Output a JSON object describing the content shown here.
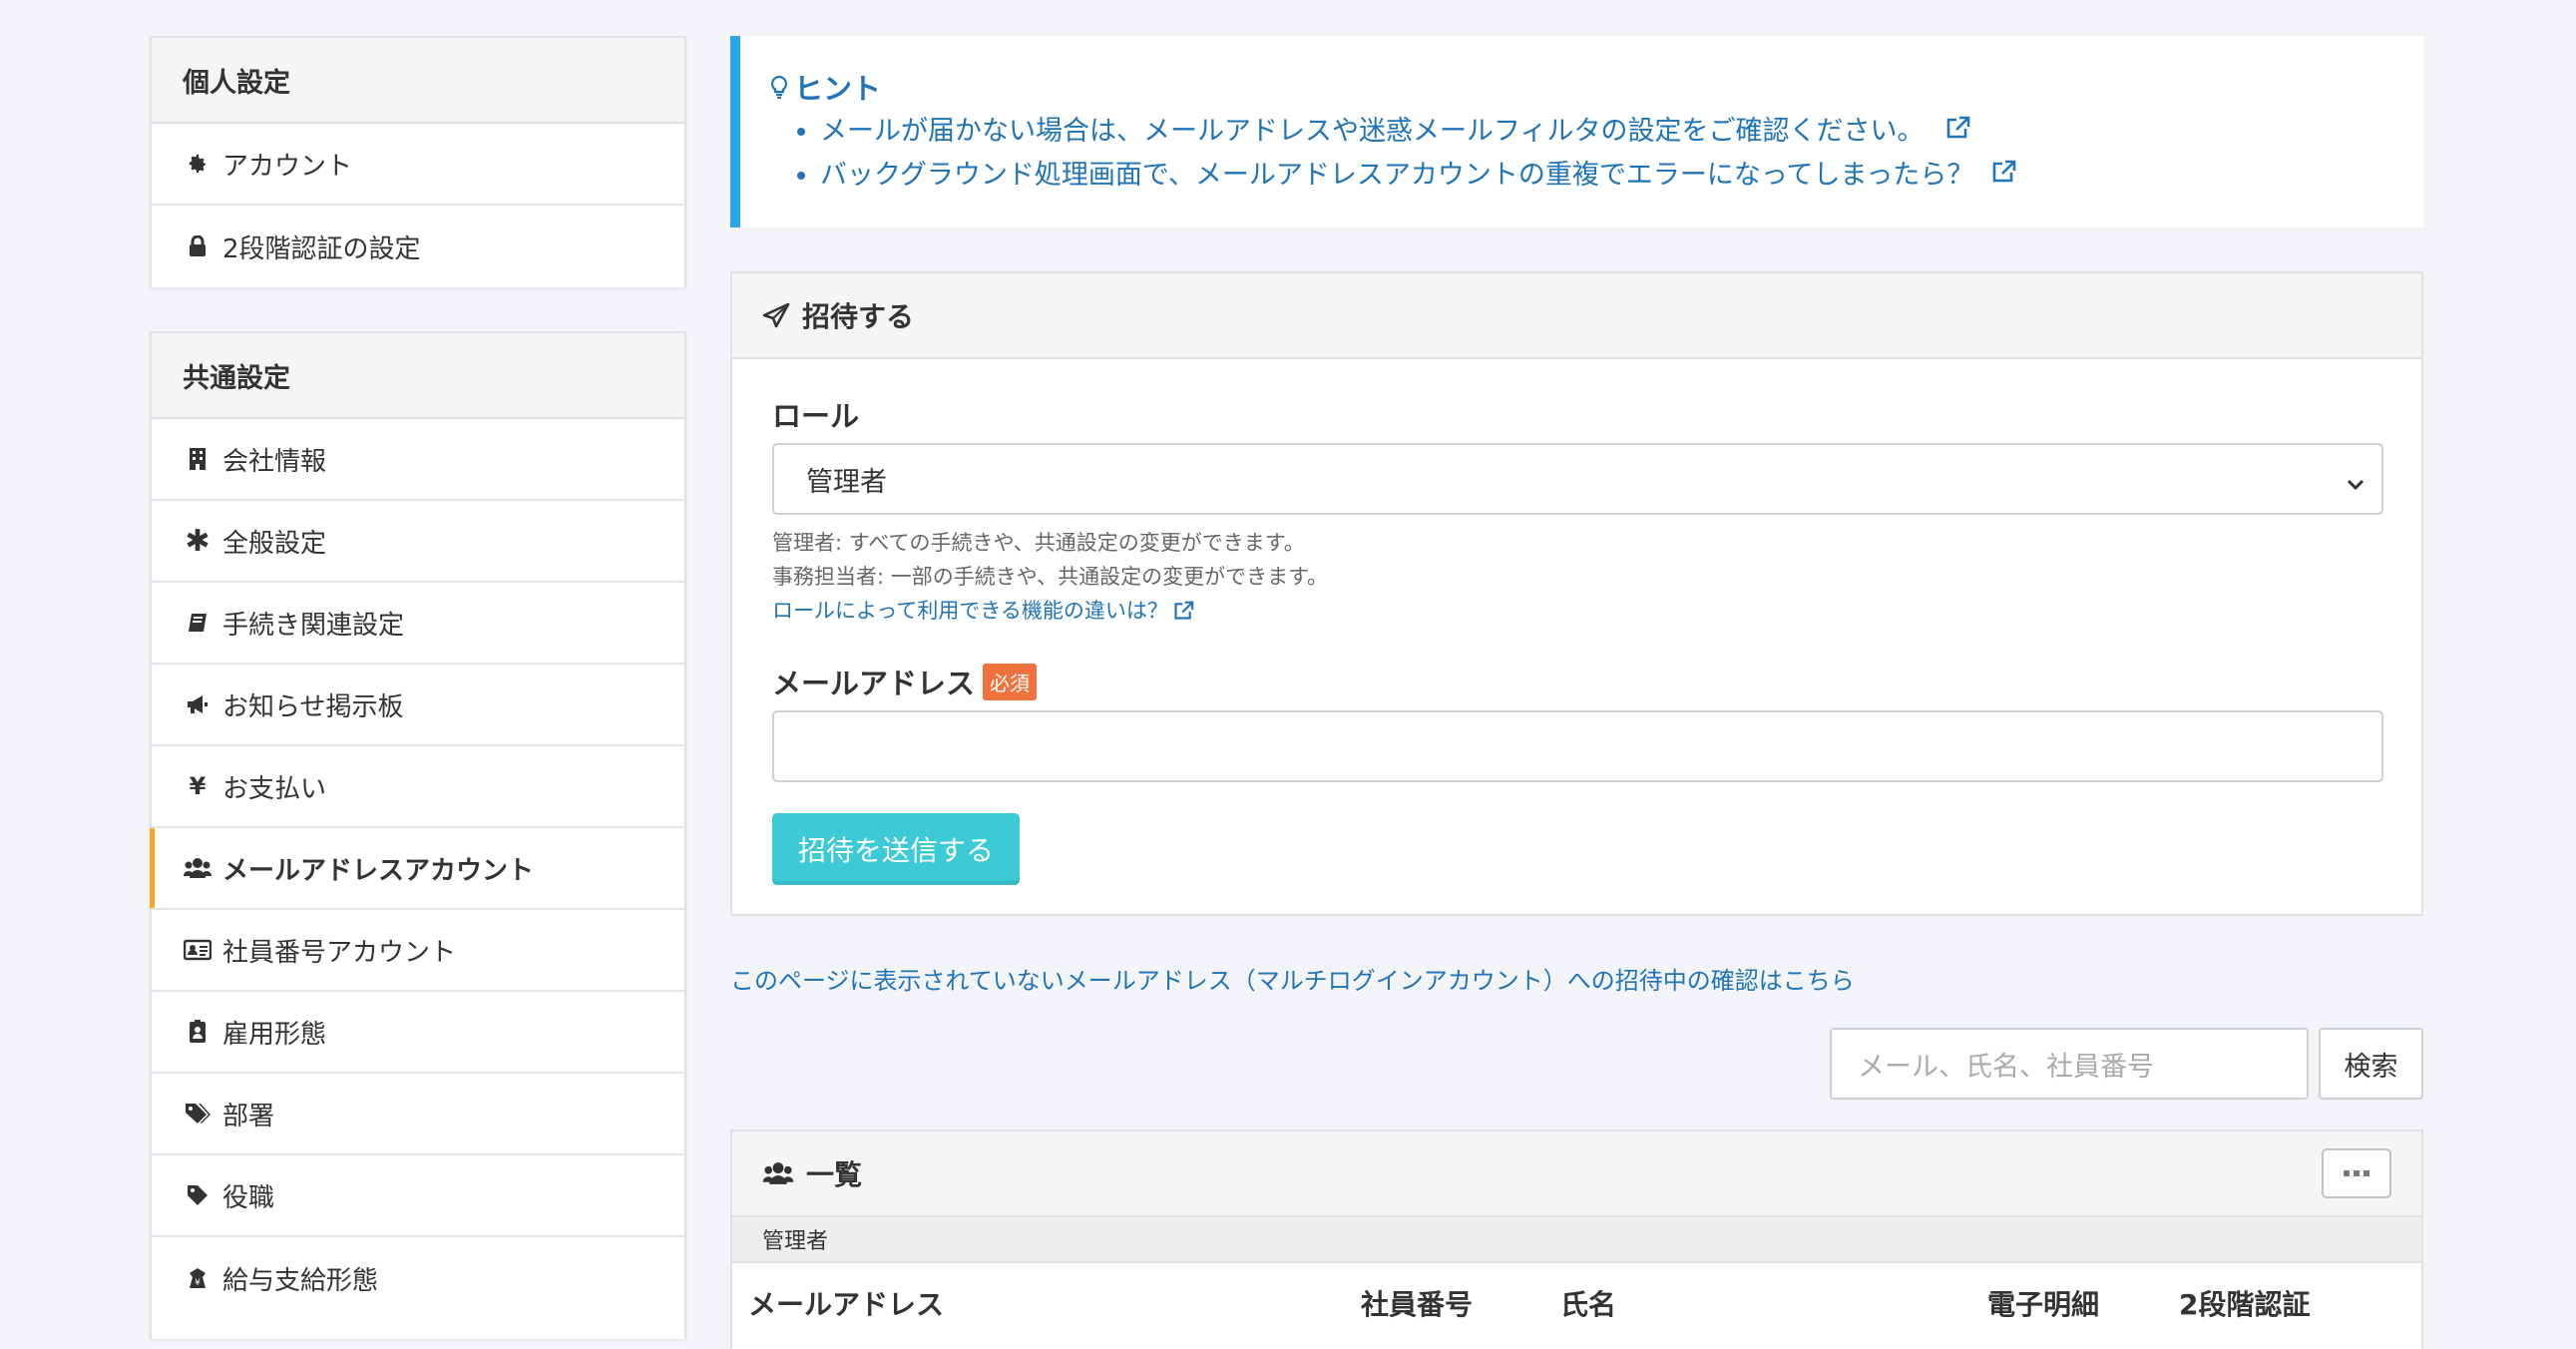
{
  "sidebar": {
    "personal": {
      "title": "個人設定",
      "items": [
        {
          "label": "アカウント",
          "icon": "gear-icon"
        },
        {
          "label": "2段階認証の設定",
          "icon": "lock-icon"
        }
      ]
    },
    "common": {
      "title": "共通設定",
      "items": [
        {
          "label": "会社情報",
          "icon": "building-icon"
        },
        {
          "label": "全般設定",
          "icon": "asterisk-icon"
        },
        {
          "label": "手続き関連設定",
          "icon": "book-icon"
        },
        {
          "label": "お知らせ掲示板",
          "icon": "megaphone-icon"
        },
        {
          "label": "お支払い",
          "icon": "yen-icon"
        },
        {
          "label": "メールアドレスアカウント",
          "icon": "users-icon",
          "active": true
        },
        {
          "label": "社員番号アカウント",
          "icon": "id-card-icon"
        },
        {
          "label": "雇用形態",
          "icon": "badge-icon"
        },
        {
          "label": "部署",
          "icon": "tags-icon"
        },
        {
          "label": "役職",
          "icon": "tag-icon"
        },
        {
          "label": "給与支給形態",
          "icon": "money-icon"
        }
      ]
    }
  },
  "hint": {
    "title": "ヒント",
    "items": [
      "メールが届かない場合は、メールアドレスや迷惑メールフィルタの設定をご確認ください。",
      "バックグラウンド処理画面で、メールアドレスアカウントの重複でエラーになってしまったら？"
    ]
  },
  "invite": {
    "title": "招待する",
    "role_label": "ロール",
    "role_value": "管理者",
    "help_admin": "管理者: すべての手続きや、共通設定の変更ができます。",
    "help_staff": "事務担当者: 一部の手続きや、共通設定の変更ができます。",
    "help_link": "ロールによって利用できる機能の違いは？",
    "email_label": "メールアドレス",
    "required_badge": "必須",
    "email_value": "",
    "submit_label": "招待を送信する"
  },
  "multi_login_link": "このページに表示されていないメールアドレス（マルチログインアカウント）への招待中の確認はこちら",
  "search": {
    "placeholder": "メール、氏名、社員番号",
    "button": "検索"
  },
  "list": {
    "title": "一覧",
    "group": "管理者",
    "columns": [
      "メールアドレス",
      "社員番号",
      "氏名",
      "電子明細",
      "2段階認証"
    ]
  },
  "colors": {
    "accent_active": "#f5a623",
    "hint_border": "#2aa6e8",
    "link": "#1f74b8",
    "primary_button": "#3ccad6",
    "required_badge": "#f0733e"
  }
}
